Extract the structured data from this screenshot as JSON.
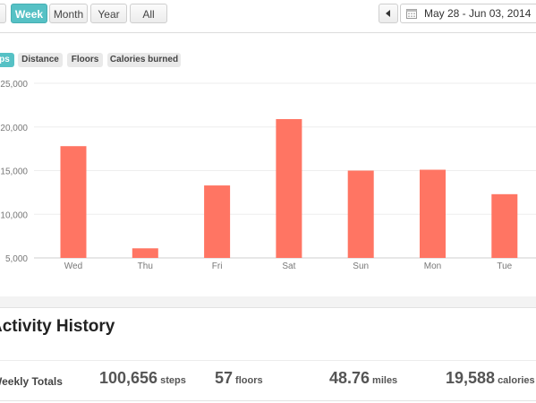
{
  "toolbar": {
    "ranges": [
      {
        "label": "Week",
        "active": true
      },
      {
        "label": "Month",
        "active": false
      },
      {
        "label": "Year",
        "active": false
      },
      {
        "label": "All",
        "active": false
      }
    ],
    "date_range": "May 28 - Jun 03, 2014",
    "icons": {
      "prev": "triangle-left-icon",
      "calendar": "calendar-icon"
    }
  },
  "metric_tabs": [
    {
      "label": "Steps",
      "visible": "ps",
      "active": true
    },
    {
      "label": "Distance",
      "active": false
    },
    {
      "label": "Floors",
      "active": false
    },
    {
      "label": "Calories burned",
      "active": false
    }
  ],
  "chart_data": {
    "type": "bar",
    "categories": [
      "Wed",
      "Thu",
      "Fri",
      "Sat",
      "Sun",
      "Mon",
      "Tue"
    ],
    "values": [
      17800,
      6100,
      13300,
      20900,
      15000,
      15100,
      12300
    ],
    "y_ticks": [
      "25,000",
      "20,000",
      "15,000",
      "10,000",
      "5,000"
    ],
    "y_tick_values": [
      25000,
      20000,
      15000,
      10000,
      5000
    ],
    "ylim": [
      5000,
      25000
    ],
    "bar_color": "#ff7563",
    "grid": true
  },
  "history": {
    "title": "Activity History",
    "totals_label": "Weekly Totals",
    "stats": [
      {
        "value": "100,656",
        "unit": "steps"
      },
      {
        "value": "57",
        "unit": "floors"
      },
      {
        "value": "48.76",
        "unit": "miles"
      },
      {
        "value": "19,588",
        "unit": "calories"
      }
    ]
  },
  "colors": {
    "accent": "#56c1c5",
    "bar": "#ff7563"
  }
}
